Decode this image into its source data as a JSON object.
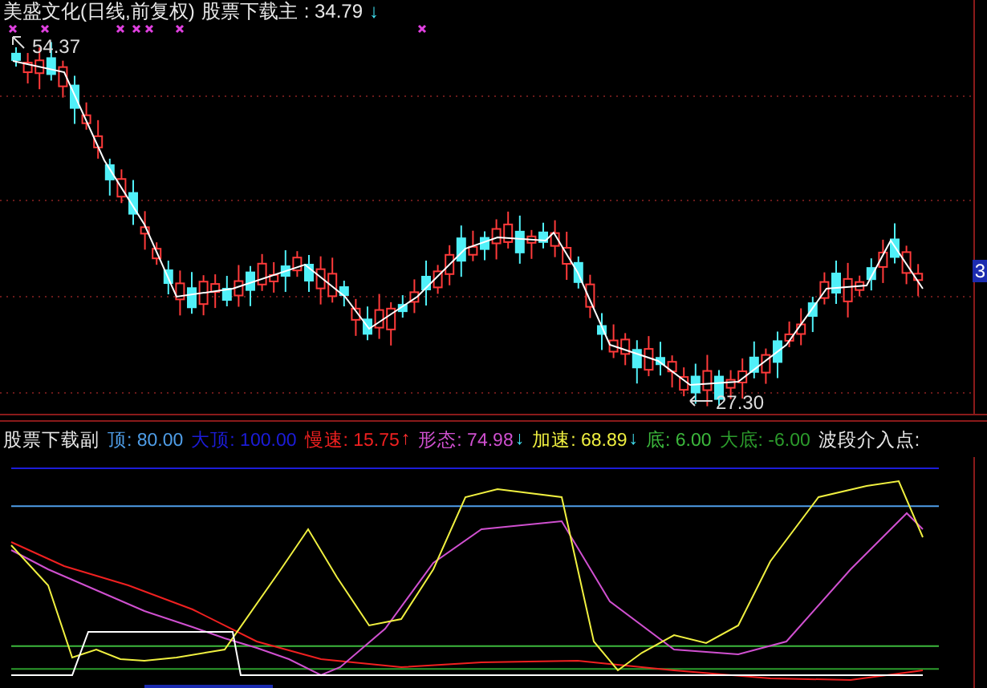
{
  "price_panel": {
    "title": "美盛文化(日线,前复权)",
    "indicator": "股票下载主",
    "value": ": 34.79",
    "arrow": {
      "symbol": "↓",
      "kind": "down"
    },
    "high_label": "54.37",
    "low_label": "27.30",
    "price_tag": "3"
  },
  "indicator_panel": {
    "name": "股票下载副",
    "items": [
      {
        "label": "顶: 80.00",
        "color": "#4f9ee8"
      },
      {
        "label": "大顶: 100.00",
        "color": "#1c1cd8"
      },
      {
        "label": "慢速: 15.75",
        "color": "#f02020",
        "arrow": {
          "symbol": "↑",
          "kind": "up"
        }
      },
      {
        "label": "形态: 74.98",
        "color": "#d050d0",
        "arrow": {
          "symbol": "↓",
          "kind": "down"
        }
      },
      {
        "label": "加速: 68.89",
        "color": "#f0f040",
        "arrow": {
          "symbol": "↓",
          "kind": "down"
        }
      },
      {
        "label": "底: 6.00",
        "color": "#3cb83c"
      },
      {
        "label": "大底: -6.00",
        "color": "#2c9c2c"
      },
      {
        "label": "波段介入点:",
        "color": "#e8e8e8"
      }
    ]
  }
}
